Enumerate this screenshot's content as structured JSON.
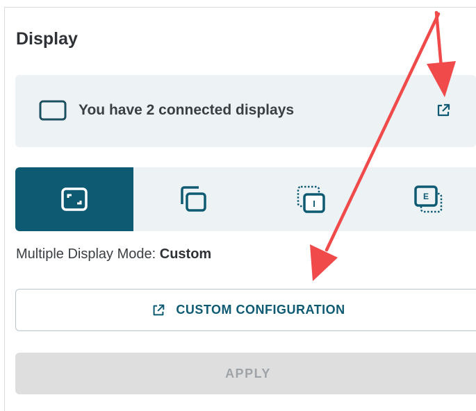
{
  "section": {
    "title": "Display"
  },
  "info": {
    "text": "You have 2 connected displays",
    "icon": "monitor-icon",
    "action_icon": "external-link-icon"
  },
  "modes": [
    {
      "name": "single",
      "icon": "single-display-icon",
      "selected": true
    },
    {
      "name": "extend",
      "icon": "extend-display-icon",
      "selected": false
    },
    {
      "name": "internal",
      "icon": "internal-display-icon",
      "label": "I",
      "selected": false
    },
    {
      "name": "external",
      "icon": "external-display-icon",
      "label": "E",
      "selected": false
    }
  ],
  "mode_status": {
    "prefix": "Multiple Display Mode: ",
    "value": "Custom"
  },
  "buttons": {
    "custom_configuration": "CUSTOM CONFIGURATION",
    "apply": "APPLY"
  },
  "colors": {
    "accent": "#0e5a73",
    "panel_bg": "#edf2f5",
    "annotation_arrow": "#f04a4a",
    "disabled_bg": "#dedede"
  }
}
